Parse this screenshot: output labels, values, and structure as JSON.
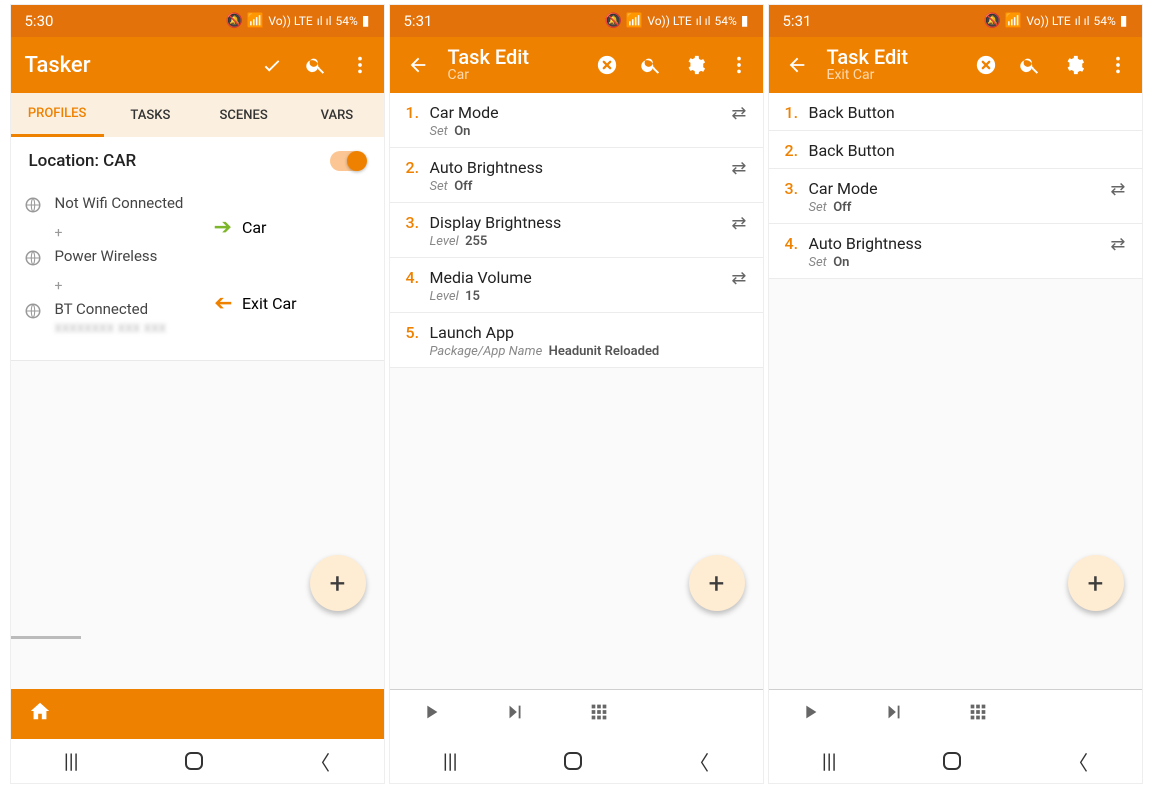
{
  "status": {
    "time1": "5:30",
    "time2": "5:31",
    "time3": "5:31",
    "battery": "54%",
    "net": "Vo)) LTE",
    "sig": "ıl ıl"
  },
  "screen1": {
    "title": "Tasker",
    "tabs": [
      "PROFILES",
      "TASKS",
      "SCENES",
      "VARS"
    ],
    "profile": {
      "name": "Location: CAR",
      "contexts": [
        {
          "label": "Not Wifi Connected"
        },
        {
          "label": "Power Wireless"
        },
        {
          "label": "BT Connected",
          "sub": "(redacted)"
        }
      ],
      "enter_task": "Car",
      "exit_task": "Exit Car"
    }
  },
  "screen2": {
    "title": "Task Edit",
    "subtitle": "Car",
    "actions": [
      {
        "n": "1.",
        "title": "Car Mode",
        "param": "Set",
        "val": "On",
        "glyph": true
      },
      {
        "n": "2.",
        "title": "Auto Brightness",
        "param": "Set",
        "val": "Off",
        "glyph": true
      },
      {
        "n": "3.",
        "title": "Display Brightness",
        "param": "Level",
        "val": "255",
        "glyph": true
      },
      {
        "n": "4.",
        "title": "Media Volume",
        "param": "Level",
        "val": "15",
        "glyph": true
      },
      {
        "n": "5.",
        "title": "Launch App",
        "param": "Package/App Name",
        "val": "Headunit Reloaded",
        "glyph": false
      }
    ]
  },
  "screen3": {
    "title": "Task Edit",
    "subtitle": "Exit Car",
    "actions": [
      {
        "n": "1.",
        "title": "Back Button",
        "param": "",
        "val": "",
        "glyph": false
      },
      {
        "n": "2.",
        "title": "Back Button",
        "param": "",
        "val": "",
        "glyph": false
      },
      {
        "n": "3.",
        "title": "Car Mode",
        "param": "Set",
        "val": "Off",
        "glyph": true
      },
      {
        "n": "4.",
        "title": "Auto Brightness",
        "param": "Set",
        "val": "On",
        "glyph": true
      }
    ]
  }
}
